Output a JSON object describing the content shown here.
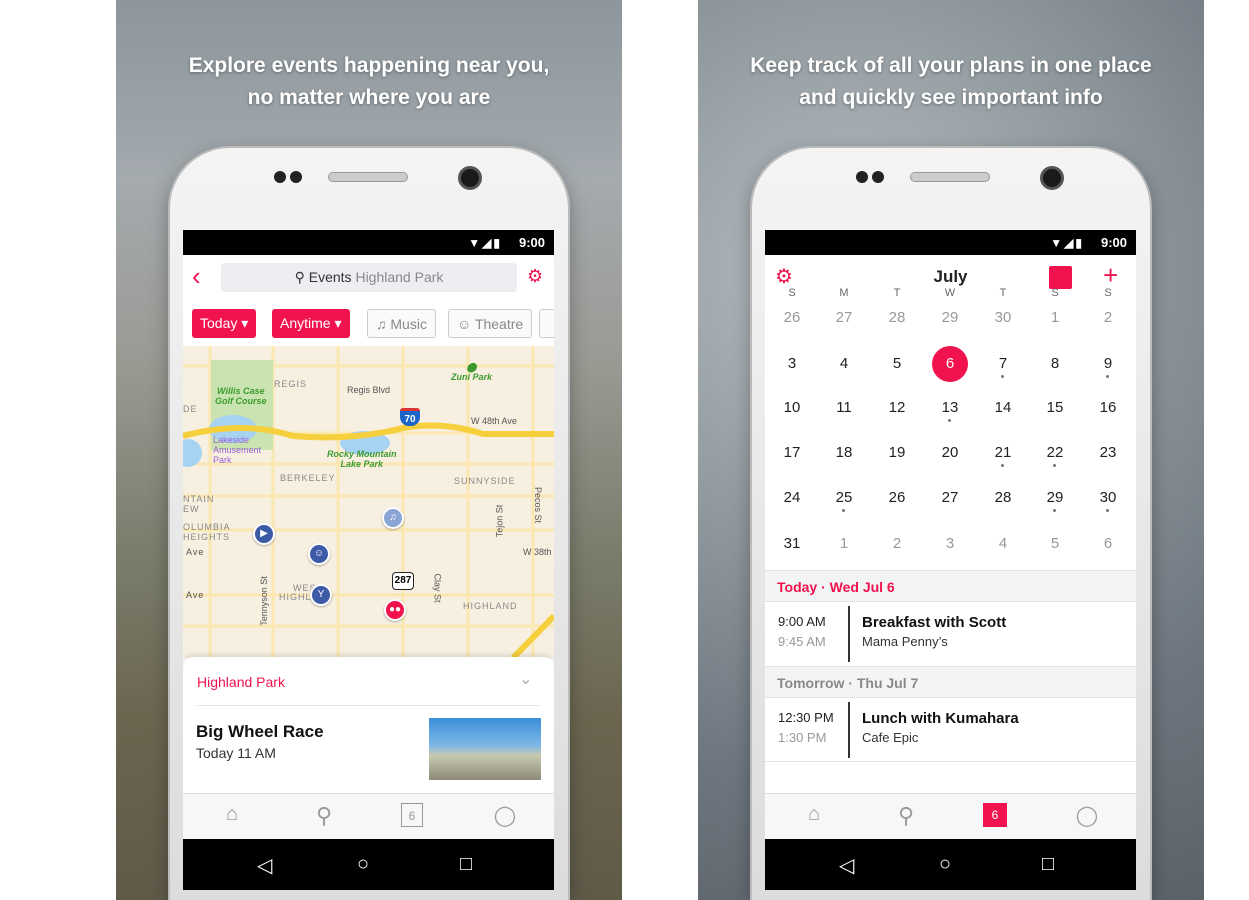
{
  "left_panel": {
    "headline_line1": "Explore events happening near you,",
    "headline_line2": "no matter where you are",
    "status_time": "9:00",
    "search": {
      "query": "Events",
      "location": "Highland Park"
    },
    "chips": [
      {
        "label": "Today",
        "active": true
      },
      {
        "label": "Anytime",
        "active": true
      },
      {
        "label": "Music",
        "icon": "music-note-icon",
        "active": false
      },
      {
        "label": "Theatre",
        "icon": "theatre-masks-icon",
        "active": false
      }
    ],
    "map": {
      "labels": [
        "REGIS",
        "Regis Blvd",
        "W 48th Ave",
        "BERKELEY",
        "SUNNYSIDE",
        "NTAIN",
        "EW",
        "OLUMBIA",
        "HEIGHTS",
        "Ave",
        "W 38th",
        "Tennyson St",
        "Tejon St",
        "Pecos St",
        "Clay St",
        "WEST",
        "HIGHLAND",
        "HIGHLAND",
        "Ave",
        "DE"
      ],
      "parks": [
        "Zuni Park",
        "Willis Case",
        "Golf Course",
        "Rocky Mountain",
        "Lake Park"
      ],
      "amusement": [
        "Lakeside",
        "Amusement",
        "Park"
      ],
      "shields": [
        "70",
        "287"
      ]
    },
    "card": {
      "area": "Highland Park",
      "event_title": "Big Wheel Race",
      "event_time": "Today 11 AM"
    },
    "bottom_nav": [
      "home-icon",
      "search-icon",
      "calendar-icon",
      "profile-icon"
    ],
    "calendar_nav_day": "6",
    "active_tab": "search"
  },
  "right_panel": {
    "headline_line1": "Keep track of all your plans in one place",
    "headline_line2": "and quickly see important info",
    "status_time": "9:00",
    "month": "July",
    "weekdays": [
      "S",
      "M",
      "T",
      "W",
      "T",
      "S",
      "S"
    ],
    "weeks": [
      [
        {
          "d": "26",
          "g": true
        },
        {
          "d": "27",
          "g": true
        },
        {
          "d": "28",
          "g": true
        },
        {
          "d": "29",
          "g": true
        },
        {
          "d": "30",
          "g": true
        },
        {
          "d": "1",
          "g": true
        },
        {
          "d": "2",
          "g": true
        }
      ],
      [
        {
          "d": "3"
        },
        {
          "d": "4"
        },
        {
          "d": "5"
        },
        {
          "d": "6",
          "sel": true
        },
        {
          "d": "7",
          "dot": true
        },
        {
          "d": "8"
        },
        {
          "d": "9",
          "dot": true
        }
      ],
      [
        {
          "d": "10"
        },
        {
          "d": "11"
        },
        {
          "d": "12"
        },
        {
          "d": "13",
          "dot": true
        },
        {
          "d": "14"
        },
        {
          "d": "15"
        },
        {
          "d": "16"
        }
      ],
      [
        {
          "d": "17"
        },
        {
          "d": "18"
        },
        {
          "d": "19"
        },
        {
          "d": "20"
        },
        {
          "d": "21",
          "dot": true
        },
        {
          "d": "22",
          "dot": true
        },
        {
          "d": "23"
        }
      ],
      [
        {
          "d": "24"
        },
        {
          "d": "25",
          "dot": true
        },
        {
          "d": "26"
        },
        {
          "d": "27"
        },
        {
          "d": "28"
        },
        {
          "d": "29",
          "dot": true
        },
        {
          "d": "30",
          "dot": true
        }
      ],
      [
        {
          "d": "31"
        },
        {
          "d": "1",
          "g": true
        },
        {
          "d": "2",
          "g": true
        },
        {
          "d": "3",
          "g": true
        },
        {
          "d": "4",
          "g": true
        },
        {
          "d": "5",
          "g": true
        },
        {
          "d": "6",
          "g": true
        }
      ]
    ],
    "sections": [
      {
        "title": "Today · Wed Jul 6",
        "events": [
          {
            "start": "9:00 AM",
            "end": "9:45 AM",
            "title": "Breakfast with Scott",
            "location": "Mama Penny’s"
          }
        ]
      },
      {
        "title": "Tomorrow · Thu Jul 7",
        "events": [
          {
            "start": "12:30 PM",
            "end": "1:30 PM",
            "title": "Lunch with Kumahara",
            "location": "Cafe Epic"
          }
        ]
      }
    ],
    "calendar_nav_day": "6",
    "active_tab": "calendar"
  },
  "colors": {
    "accent": "#f0134d",
    "map_bg": "#f7efe0",
    "road": "#f5cf3c",
    "park": "#c9e4b0",
    "pin": "#3c5aa6"
  }
}
